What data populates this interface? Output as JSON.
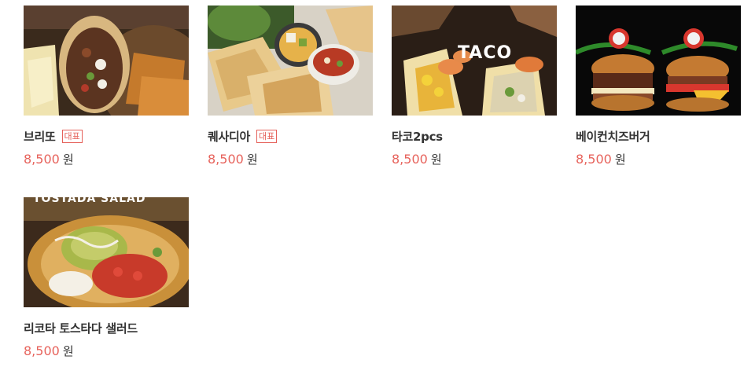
{
  "menu": {
    "items": [
      {
        "name": "브리또",
        "badge": "대표",
        "price": "8,500",
        "currency": "원"
      },
      {
        "name": "퀘사디아",
        "badge": "대표",
        "price": "8,500",
        "currency": "원"
      },
      {
        "name": "타코2pcs",
        "price": "8,500",
        "currency": "원",
        "image_text": "TACO"
      },
      {
        "name": "베이컨치즈버거",
        "price": "8,500",
        "currency": "원"
      },
      {
        "name": "리코타 토스타다 샐러드",
        "price": "8,500",
        "currency": "원",
        "image_text": "TOSTADA SALAD"
      }
    ]
  },
  "colors": {
    "accent": "#e7635c",
    "text": "#333333"
  }
}
